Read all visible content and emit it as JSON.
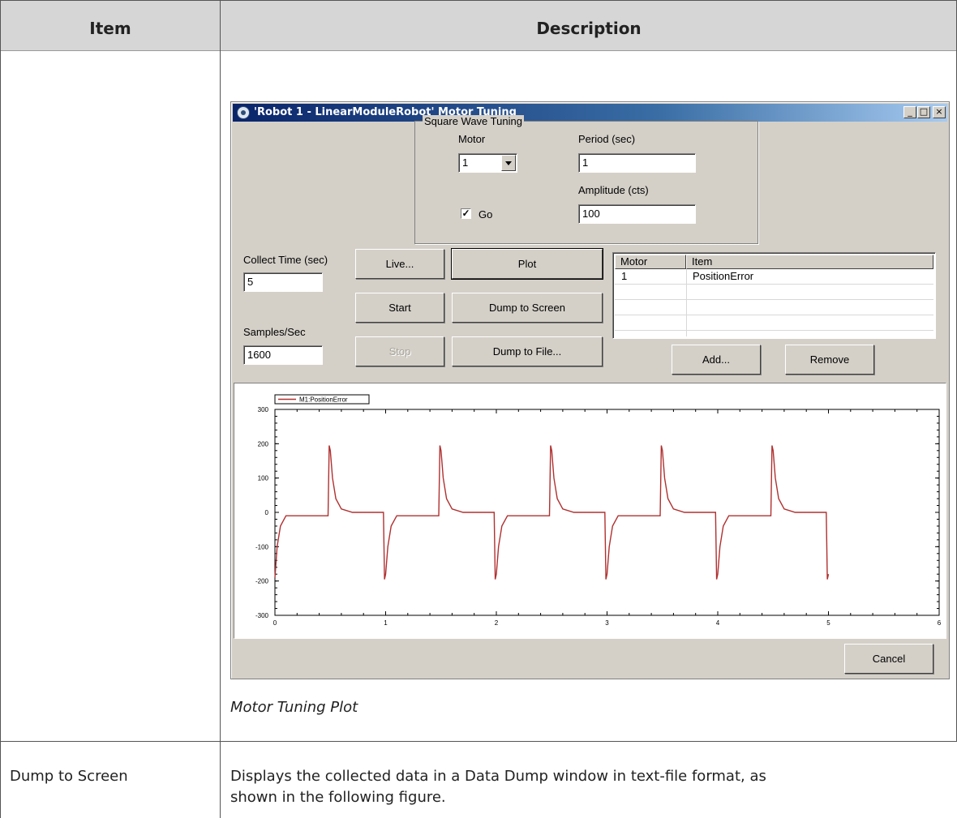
{
  "table": {
    "header_item": "Item",
    "header_description": "Description",
    "caption": "Motor Tuning Plot",
    "rows": [
      {
        "item": "Dump to Screen",
        "description_line1": "Displays the collected data in a Data Dump window in text-file format, as",
        "description_line2": "shown in the following figure."
      }
    ]
  },
  "window": {
    "title": "'Robot 1 - LinearModuleRobot' Motor Tuning",
    "minimize_glyph": "_",
    "maximize_glyph": "□",
    "close_glyph": "×",
    "group": {
      "title": "Square Wave Tuning",
      "motor_label": "Motor",
      "motor_value": "1",
      "period_label": "Period (sec)",
      "period_value": "1",
      "amplitude_label": "Amplitude (cts)",
      "amplitude_value": "100",
      "go_label": "Go",
      "go_checked": true,
      "go_check_glyph": "✓"
    },
    "collect_time_label": "Collect Time (sec)",
    "collect_time_value": "5",
    "samples_label": "Samples/Sec",
    "samples_value": "1600",
    "buttons": {
      "live": "Live...",
      "start": "Start",
      "stop": "Stop",
      "plot": "Plot",
      "dump_screen": "Dump to Screen",
      "dump_file": "Dump to File...",
      "add": "Add...",
      "remove": "Remove",
      "cancel": "Cancel"
    },
    "list": {
      "columns": [
        "Motor",
        "Item"
      ],
      "rows": [
        {
          "motor": "1",
          "item": "PositionError"
        }
      ]
    }
  },
  "chart_data": {
    "type": "line",
    "legend": [
      "M1:PositionError"
    ],
    "legend_placement": "top-left",
    "grid": false,
    "xlim": [
      0,
      6
    ],
    "ylim": [
      -300,
      300
    ],
    "x_ticks": [
      "0",
      "1",
      "2",
      "3",
      "4",
      "5",
      "6"
    ],
    "y_ticks": [
      "300",
      "200",
      "100",
      "0",
      "-100",
      "-200",
      "-300"
    ],
    "series_color": "#b03030",
    "series": [
      {
        "name": "M1:PositionError",
        "x": [
          0,
          0.02,
          0.05,
          0.1,
          0.2,
          0.48,
          0.49,
          0.5,
          0.52,
          0.55,
          0.6,
          0.7,
          0.98,
          0.99,
          1.0,
          1.02,
          1.05,
          1.1,
          1.2,
          1.48,
          1.49,
          1.5,
          1.52,
          1.55,
          1.6,
          1.7,
          1.98,
          1.99,
          2.0,
          2.02,
          2.05,
          2.1,
          2.2,
          2.48,
          2.49,
          2.5,
          2.52,
          2.55,
          2.6,
          2.7,
          2.98,
          2.99,
          3.0,
          3.02,
          3.05,
          3.1,
          3.2,
          3.48,
          3.49,
          3.5,
          3.52,
          3.55,
          3.6,
          3.7,
          3.98,
          3.99,
          4.0,
          4.02,
          4.05,
          4.1,
          4.2,
          4.48,
          4.49,
          4.5,
          4.52,
          4.55,
          4.6,
          4.7,
          4.98,
          4.99,
          5.0
        ],
        "y": [
          -190,
          -100,
          -40,
          -10,
          -10,
          -10,
          195,
          180,
          100,
          40,
          10,
          0,
          0,
          -195,
          -180,
          -100,
          -40,
          -10,
          -10,
          -10,
          195,
          180,
          100,
          40,
          10,
          0,
          0,
          -195,
          -180,
          -100,
          -40,
          -10,
          -10,
          -10,
          195,
          180,
          100,
          40,
          10,
          0,
          0,
          -195,
          -180,
          -100,
          -40,
          -10,
          -10,
          -10,
          195,
          180,
          100,
          40,
          10,
          0,
          0,
          -195,
          -180,
          -100,
          -40,
          -10,
          -10,
          -10,
          195,
          180,
          100,
          40,
          10,
          0,
          0,
          -195,
          -180
        ]
      }
    ]
  }
}
